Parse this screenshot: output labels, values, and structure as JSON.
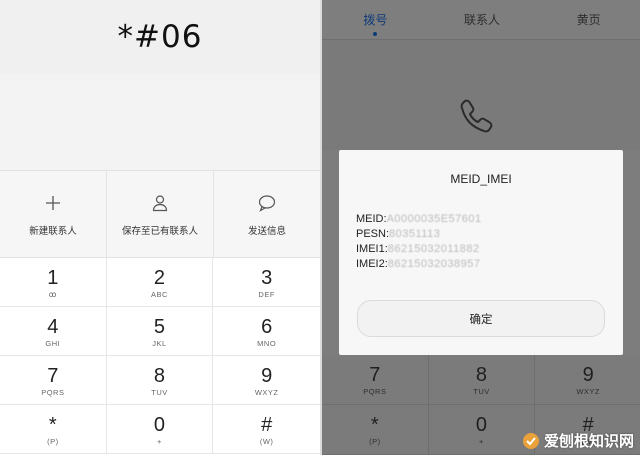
{
  "left": {
    "dialed": "*#06",
    "actions": [
      {
        "label": "新建联系人",
        "icon": "plus-icon"
      },
      {
        "label": "保存至已有联系人",
        "icon": "person-icon"
      },
      {
        "label": "发送信息",
        "icon": "message-icon"
      }
    ],
    "keys": [
      {
        "digit": "1",
        "letters": "ꝏ"
      },
      {
        "digit": "2",
        "letters": "ABC"
      },
      {
        "digit": "3",
        "letters": "DEF"
      },
      {
        "digit": "4",
        "letters": "GHI"
      },
      {
        "digit": "5",
        "letters": "JKL"
      },
      {
        "digit": "6",
        "letters": "MNO"
      },
      {
        "digit": "7",
        "letters": "PQRS"
      },
      {
        "digit": "8",
        "letters": "TUV"
      },
      {
        "digit": "9",
        "letters": "WXYZ"
      },
      {
        "digit": "*",
        "letters": "(P)"
      },
      {
        "digit": "0",
        "letters": "+"
      },
      {
        "digit": "#",
        "letters": "(W)"
      }
    ]
  },
  "right": {
    "tabs": [
      "拨号",
      "联系人",
      "黄页"
    ],
    "dialog": {
      "title": "MEID_IMEI",
      "lines": [
        {
          "label": "MEID:",
          "value": "A0000035E57601"
        },
        {
          "label": "PESN:",
          "value": "80351113"
        },
        {
          "label": "IMEI1:",
          "value": "86215032011882"
        },
        {
          "label": "IMEI2:",
          "value": "86215032038957"
        }
      ],
      "ok": "确定"
    },
    "keys": [
      {
        "digit": "7",
        "letters": "PQRS"
      },
      {
        "digit": "8",
        "letters": "TUV"
      },
      {
        "digit": "9",
        "letters": "WXYZ"
      },
      {
        "digit": "*",
        "letters": "(P)"
      },
      {
        "digit": "0",
        "letters": "+"
      },
      {
        "digit": "#",
        "letters": "(W)"
      }
    ]
  },
  "watermark": "爱刨根知识网"
}
